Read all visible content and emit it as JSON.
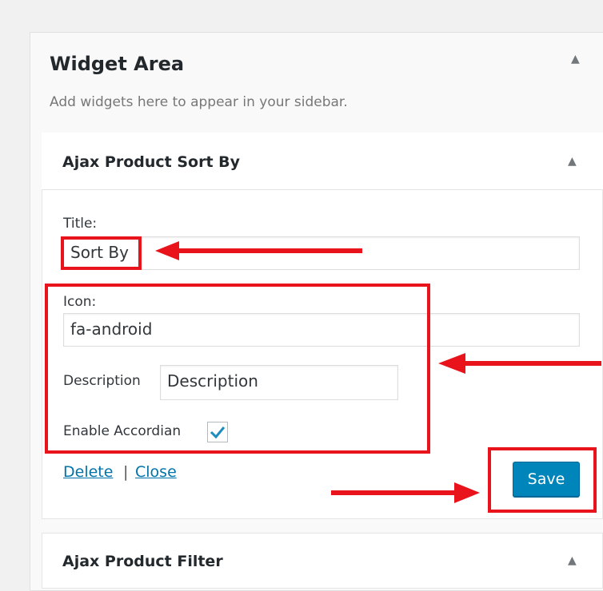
{
  "widget_area": {
    "title": "Widget Area",
    "description": "Add widgets here to appear in your sidebar.",
    "toggle_icon": "triangle-up"
  },
  "widget_sort": {
    "title": "Ajax Product Sort By",
    "toggle_icon": "triangle-up",
    "title_label": "Title:",
    "title_value": "Sort By",
    "icon_label": "Icon:",
    "icon_value": "fa-android",
    "description_label": "Description",
    "description_value": "Description",
    "accordion_label": "Enable Accordian",
    "accordion_checked": true,
    "delete_link": "Delete",
    "separator": "|",
    "close_link": "Close",
    "save_label": "Save"
  },
  "widget_filter": {
    "title": "Ajax Product Filter",
    "toggle_icon": "triangle-up"
  },
  "colors": {
    "annotation_red": "#e8131b",
    "primary_button": "#0085ba",
    "link": "#0073aa"
  }
}
